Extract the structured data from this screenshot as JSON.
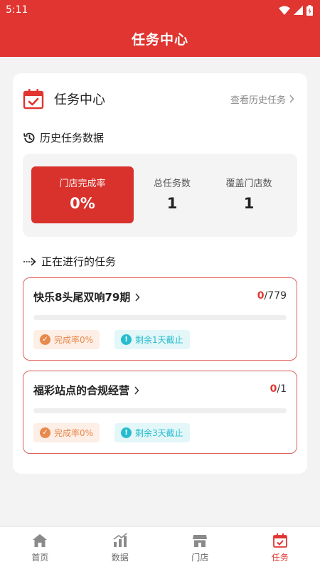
{
  "status_bar": {
    "time": "5:11"
  },
  "header": {
    "title": "任务中心"
  },
  "card": {
    "title": "任务中心",
    "history_link": "查看历史任务"
  },
  "history": {
    "section_title": "历史任务数据",
    "stats": [
      {
        "label": "门店完成率",
        "value": "0%"
      },
      {
        "label": "总任务数",
        "value": "1"
      },
      {
        "label": "覆盖门店数",
        "value": "1"
      }
    ]
  },
  "ongoing": {
    "section_title": "正在进行的任务",
    "tasks": [
      {
        "name": "快乐8头尾双响79期",
        "done": "0",
        "total": "/779",
        "progress": 0,
        "completion_tag": "完成率0%",
        "deadline_tag": "剩余1天截止"
      },
      {
        "name": "福彩站点的合规经营",
        "done": "0",
        "total": "/1",
        "progress": 0,
        "completion_tag": "完成率0%",
        "deadline_tag": "剩余3天截止"
      }
    ]
  },
  "tabbar": {
    "items": [
      {
        "label": "首页",
        "icon": "home-icon"
      },
      {
        "label": "数据",
        "icon": "chart-icon"
      },
      {
        "label": "门店",
        "icon": "store-icon"
      },
      {
        "label": "任务",
        "icon": "task-calendar-icon"
      }
    ],
    "active_index": 3
  },
  "colors": {
    "primary": "#e03530",
    "orange": "#e78a4c",
    "cyan": "#27bccd"
  }
}
